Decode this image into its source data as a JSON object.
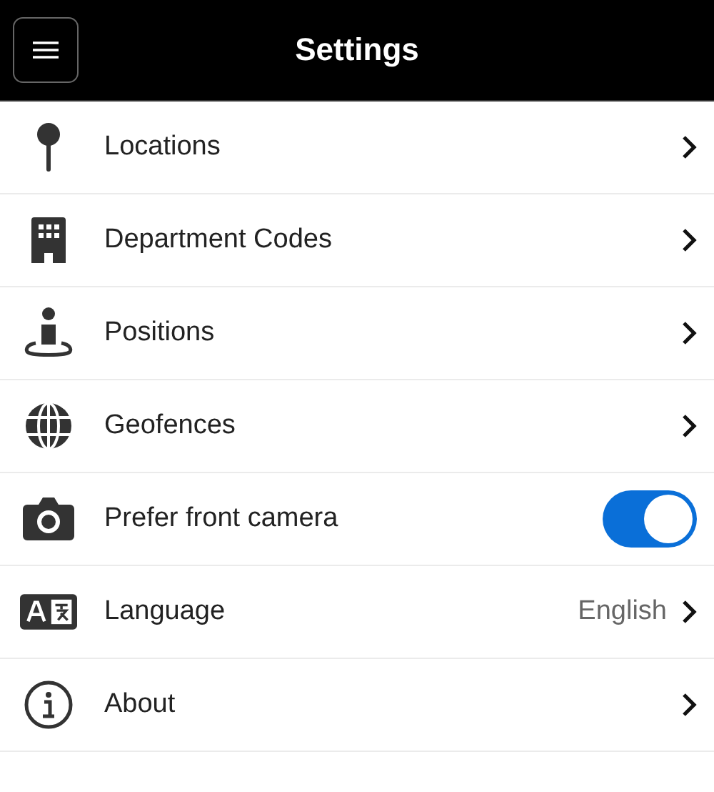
{
  "header": {
    "title": "Settings"
  },
  "items": [
    {
      "kind": "link",
      "label": "Locations"
    },
    {
      "kind": "link",
      "label": "Department Codes"
    },
    {
      "kind": "link",
      "label": "Positions"
    },
    {
      "kind": "link",
      "label": "Geofences"
    },
    {
      "kind": "toggle",
      "label": "Prefer front camera",
      "on": true
    },
    {
      "kind": "link",
      "label": "Language",
      "value": "English"
    },
    {
      "kind": "link",
      "label": "About"
    }
  ]
}
